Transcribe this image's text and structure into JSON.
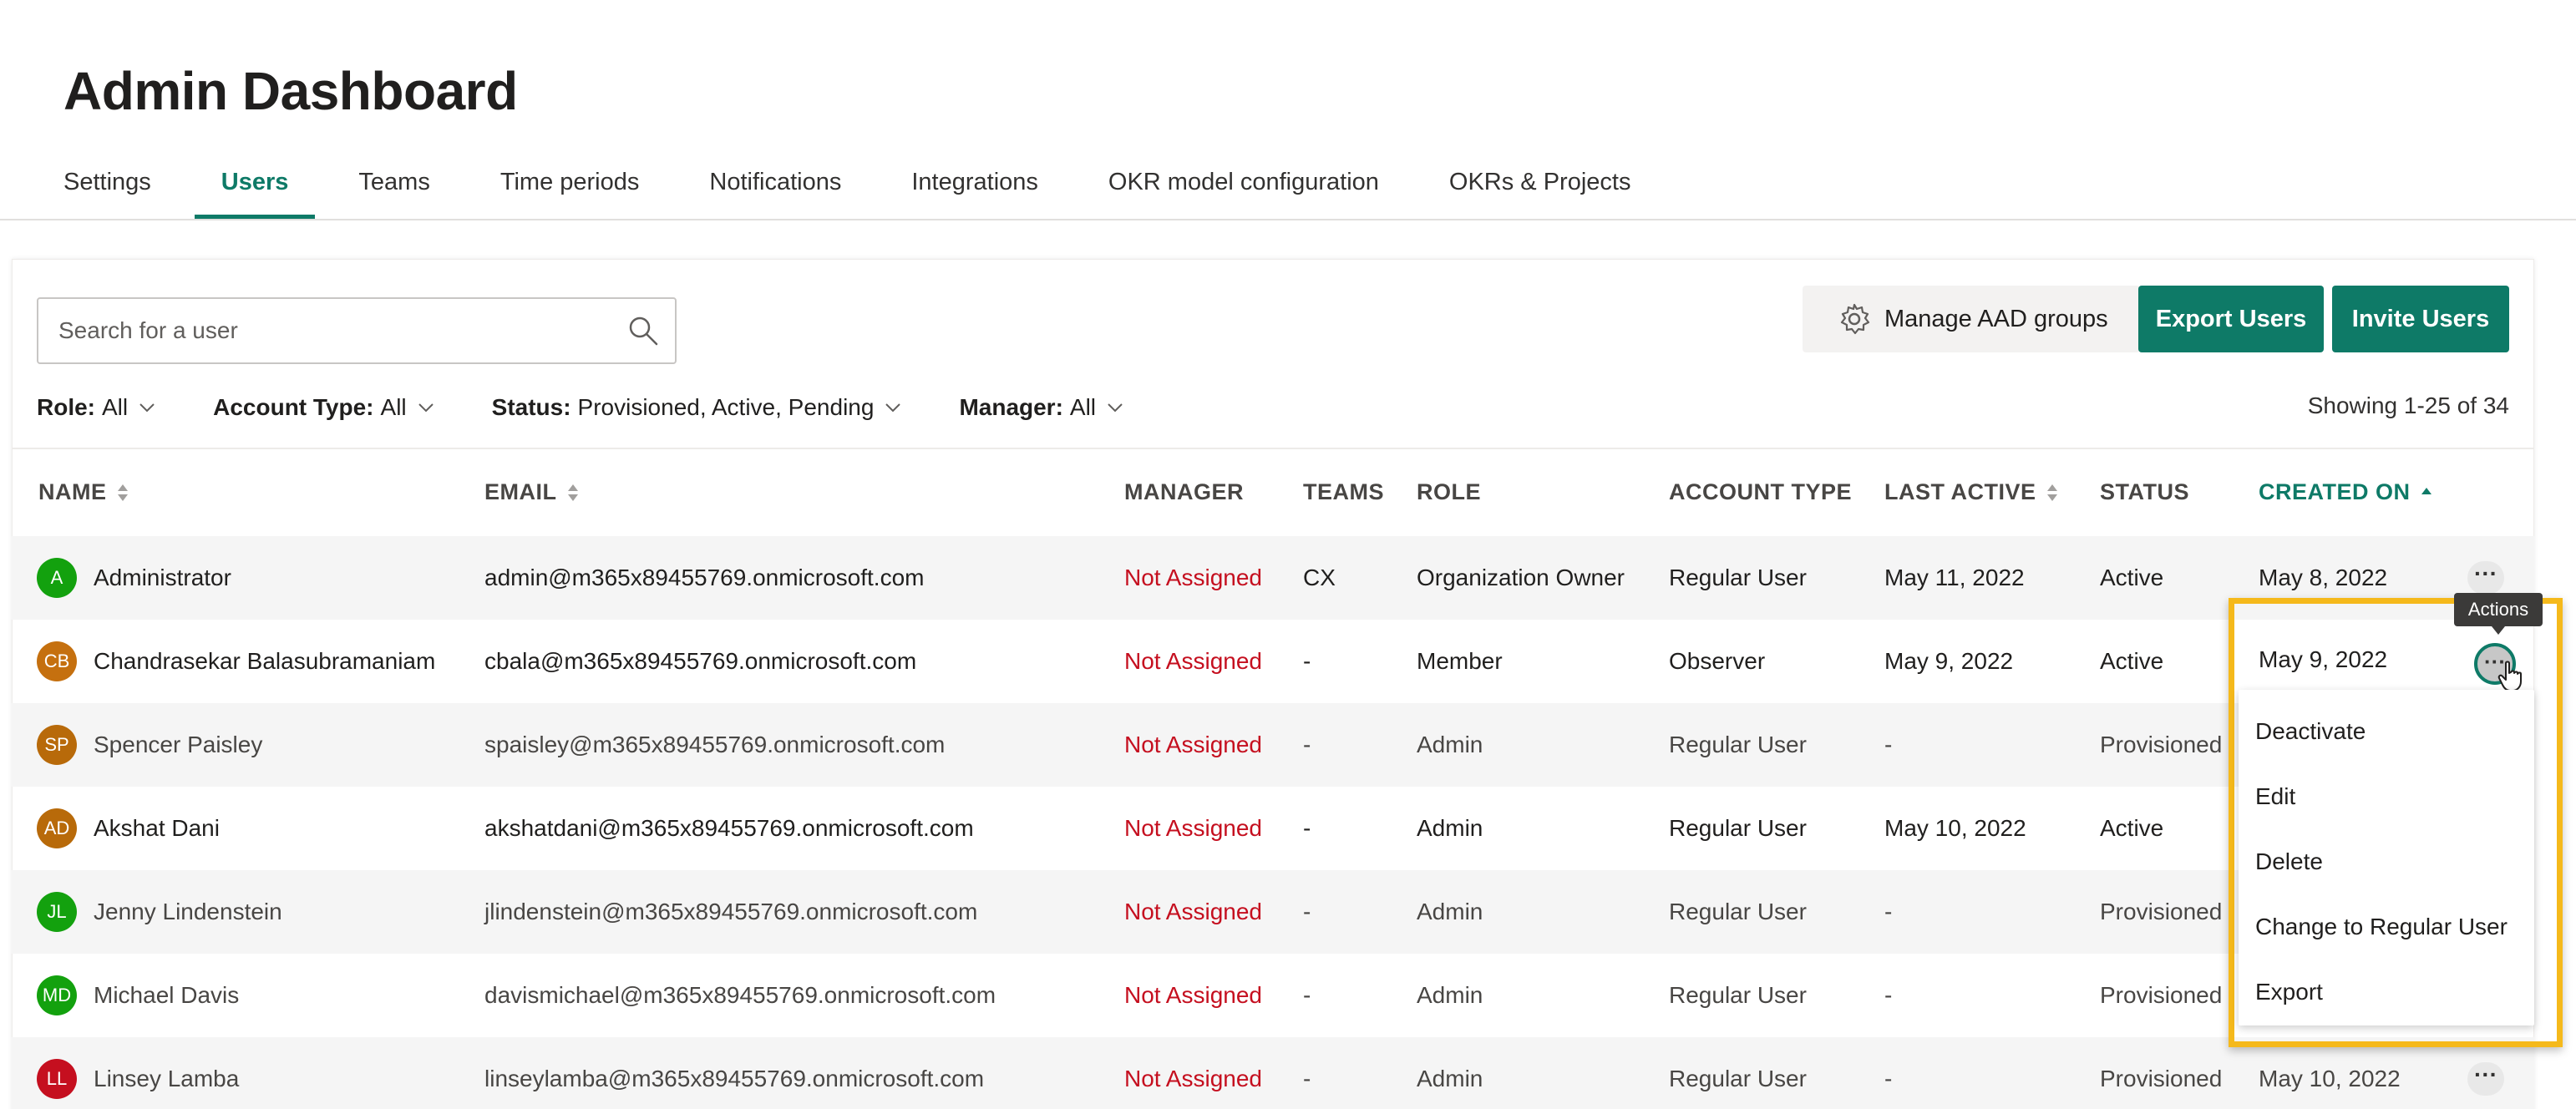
{
  "page": {
    "title": "Admin Dashboard"
  },
  "tabs": [
    {
      "label": "Settings"
    },
    {
      "label": "Users"
    },
    {
      "label": "Teams"
    },
    {
      "label": "Time periods"
    },
    {
      "label": "Notifications"
    },
    {
      "label": "Integrations"
    },
    {
      "label": "OKR model configuration"
    },
    {
      "label": "OKRs & Projects"
    }
  ],
  "active_tab": "Users",
  "search": {
    "placeholder": "Search for a user",
    "value": ""
  },
  "toolbar": {
    "manage_aad_label": "Manage AAD groups",
    "export_label": "Export Users",
    "invite_label": "Invite Users"
  },
  "filters": {
    "role": {
      "key": "Role:",
      "value": "All"
    },
    "account_type": {
      "key": "Account Type:",
      "value": "All"
    },
    "status": {
      "key": "Status:",
      "value": "Provisioned, Active, Pending"
    },
    "manager": {
      "key": "Manager:",
      "value": "All"
    }
  },
  "showing": "Showing 1-25 of 34",
  "columns": {
    "name": "NAME",
    "email": "EMAIL",
    "manager": "MANAGER",
    "teams": "TEAMS",
    "role": "ROLE",
    "account_type": "ACCOUNT TYPE",
    "last_active": "LAST ACTIVE",
    "status": "STATUS",
    "created_on": "CREATED ON"
  },
  "rows": [
    {
      "initials": "A",
      "avatar_color": "#13a10e",
      "name": "Administrator",
      "email": "admin@m365x89455769.onmicrosoft.com",
      "manager": "Not Assigned",
      "teams": "CX",
      "role": "Organization Owner",
      "account_type": "Regular User",
      "last_active": "May 11, 2022",
      "status": "Active",
      "created_on": "May 8, 2022",
      "more": "···"
    },
    {
      "initials": "CB",
      "avatar_color": "#c5700f",
      "name": "Chandrasekar Balasubramaniam",
      "email": "cbala@m365x89455769.onmicrosoft.com",
      "manager": "Not Assigned",
      "teams": "-",
      "role": "Member",
      "account_type": "Observer",
      "last_active": "May 9, 2022",
      "status": "Active",
      "created_on": "",
      "more": ""
    },
    {
      "initials": "SP",
      "avatar_color": "#b86a0a",
      "name": "Spencer Paisley",
      "email": "spaisley@m365x89455769.onmicrosoft.com",
      "manager": "Not Assigned",
      "teams": "-",
      "role": "Admin",
      "account_type": "Regular User",
      "last_active": "-",
      "status": "Provisioned",
      "created_on": "",
      "more": ""
    },
    {
      "initials": "AD",
      "avatar_color": "#b86a0a",
      "name": "Akshat Dani",
      "email": "akshatdani@m365x89455769.onmicrosoft.com",
      "manager": "Not Assigned",
      "teams": "-",
      "role": "Admin",
      "account_type": "Regular User",
      "last_active": "May 10, 2022",
      "status": "Active",
      "created_on": "",
      "more": ""
    },
    {
      "initials": "JL",
      "avatar_color": "#13a10e",
      "name": "Jenny Lindenstein",
      "email": "jlindenstein@m365x89455769.onmicrosoft.com",
      "manager": "Not Assigned",
      "teams": "-",
      "role": "Admin",
      "account_type": "Regular User",
      "last_active": "-",
      "status": "Provisioned",
      "created_on": "",
      "more": ""
    },
    {
      "initials": "MD",
      "avatar_color": "#13a10e",
      "name": "Michael Davis",
      "email": "davismichael@m365x89455769.onmicrosoft.com",
      "manager": "Not Assigned",
      "teams": "-",
      "role": "Admin",
      "account_type": "Regular User",
      "last_active": "-",
      "status": "Provisioned",
      "created_on": "",
      "more": ""
    },
    {
      "initials": "LL",
      "avatar_color": "#c50f1f",
      "name": "Linsey Lamba",
      "email": "linseylamba@m365x89455769.onmicrosoft.com",
      "manager": "Not Assigned",
      "teams": "-",
      "role": "Admin",
      "account_type": "Regular User",
      "last_active": "-",
      "status": "Provisioned",
      "created_on": "May 10, 2022",
      "more": "···"
    }
  ],
  "actions_menu": {
    "tooltip": "Actions",
    "row_created_on": "May 9, 2022",
    "more_glyph": "···",
    "items": [
      {
        "label": "Deactivate"
      },
      {
        "label": "Edit"
      },
      {
        "label": "Delete"
      },
      {
        "label": "Change to Regular User"
      },
      {
        "label": "Export"
      }
    ]
  },
  "icons": {
    "search": "search-icon",
    "gear": "gear-icon",
    "chevron": "chevron-down-icon",
    "sort": "sort-icon",
    "sort_asc": "sort-ascending-icon",
    "more": "more-horizontal-icon",
    "cursor": "hand-pointer-icon"
  },
  "colors": {
    "accent": "#0e7a67",
    "not_assigned": "#c50f1f",
    "highlight": "#f5b91b",
    "row_alt": "#f5f5f5"
  }
}
